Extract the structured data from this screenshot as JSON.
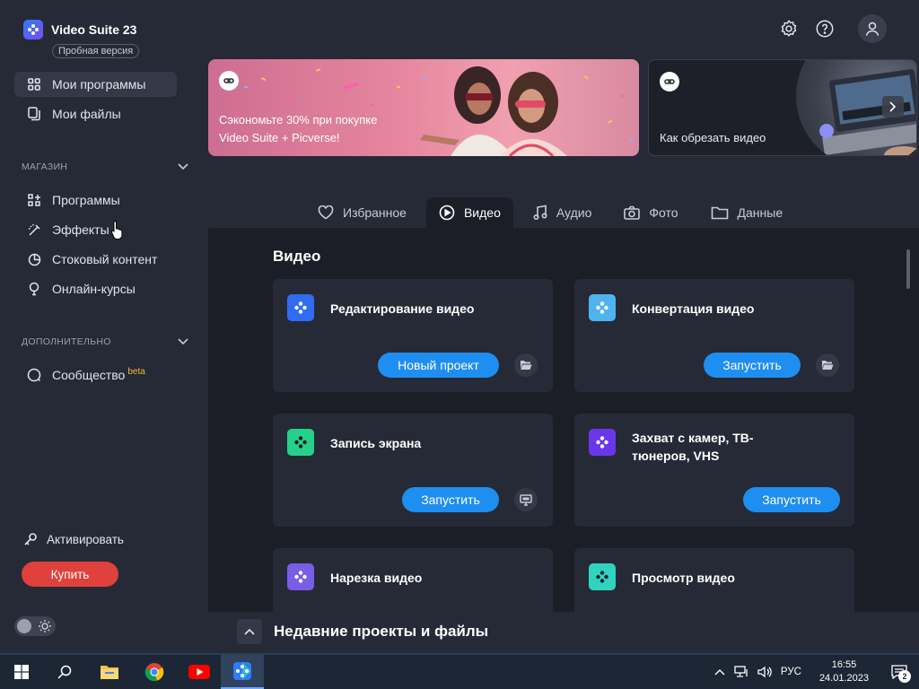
{
  "app": {
    "title": "Video Suite 23",
    "trial_label": "Пробная версия"
  },
  "sidebar": {
    "main_items": [
      {
        "label": "Мои программы",
        "icon": "grid-icon"
      },
      {
        "label": "Мои файлы",
        "icon": "files-icon"
      }
    ],
    "store_heading": "МАГАЗИН",
    "store_items": [
      {
        "label": "Программы",
        "icon": "apps-icon"
      },
      {
        "label": "Эффекты",
        "icon": "magic-wand-icon"
      },
      {
        "label": "Стоковый контент",
        "icon": "pie-icon"
      },
      {
        "label": "Онлайн-курсы",
        "icon": "lightbulb-icon"
      }
    ],
    "extra_heading": "ДОПОЛНИТЕЛЬНО",
    "extra_items": [
      {
        "label": "Сообщество",
        "badge": "beta",
        "icon": "chat-icon"
      }
    ],
    "activate_label": "Активировать",
    "buy_label": "Купить"
  },
  "banners": {
    "promo_text_line1": "Сэкономьте 30% при покупке",
    "promo_text_line2": "Video Suite + Picverse!",
    "tutorial_text": "Как обрезать видео"
  },
  "tabs": [
    {
      "label": "Избранное",
      "icon": "heart-icon"
    },
    {
      "label": "Видео",
      "icon": "play-circle-icon"
    },
    {
      "label": "Аудио",
      "icon": "music-note-icon"
    },
    {
      "label": "Фото",
      "icon": "camera-icon"
    },
    {
      "label": "Данные",
      "icon": "folder-icon"
    }
  ],
  "panel": {
    "title": "Видео",
    "cards": [
      {
        "title": "Редактирование видео",
        "button": "Новый проект",
        "aux_icon": "folder-open-icon",
        "color": "#2f6cf2"
      },
      {
        "title": "Конвертация видео",
        "button": "Запустить",
        "aux_icon": "folder-open-icon",
        "color": "#4fb3ef"
      },
      {
        "title": "Запись экрана",
        "button": "Запустить",
        "aux_icon": "monitor-icon",
        "color": "#27d08a"
      },
      {
        "title": "Захват с камер, ТВ-тюнеров, VHS",
        "button": "Запустить",
        "color": "#6a37e8"
      },
      {
        "title": "Нарезка видео",
        "color": "#7b5ce6"
      },
      {
        "title": "Просмотр видео",
        "color": "#2fd3c0"
      }
    ]
  },
  "recent": {
    "title": "Недавние проекты и файлы"
  },
  "taskbar": {
    "language": "РУС",
    "time": "16:55",
    "date": "24.01.2023",
    "notification_count": "2"
  }
}
